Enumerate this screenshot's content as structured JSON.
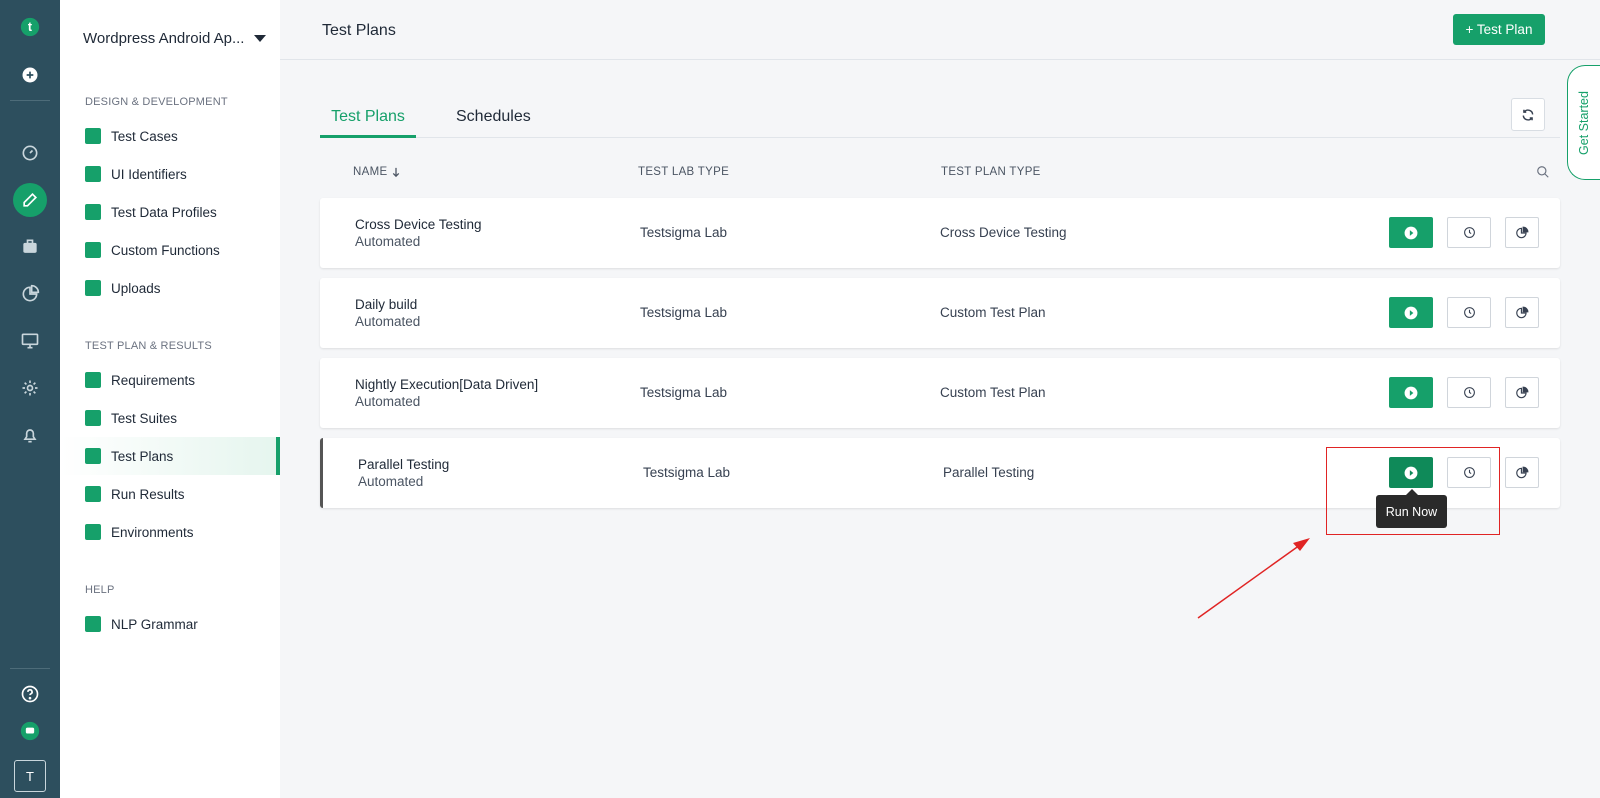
{
  "rail": {
    "logo_letter": "t",
    "user_initial": "T"
  },
  "sidenav": {
    "project_name": "Wordpress Android Ap...",
    "sections": [
      {
        "title": "DESIGN & DEVELOPMENT",
        "items": [
          "Test Cases",
          "UI Identifiers",
          "Test Data Profiles",
          "Custom Functions",
          "Uploads"
        ]
      },
      {
        "title": "TEST PLAN & RESULTS",
        "items": [
          "Requirements",
          "Test Suites",
          "Test Plans",
          "Run Results",
          "Environments"
        ]
      },
      {
        "title": "HELP",
        "items": [
          "NLP Grammar"
        ]
      }
    ],
    "active_item": "Test Plans"
  },
  "header": {
    "title": "Test Plans",
    "new_button": "+ Test Plan"
  },
  "get_started": "Get Started",
  "tabs": [
    "Test Plans",
    "Schedules"
  ],
  "table": {
    "columns": [
      "NAME",
      "TEST LAB TYPE",
      "TEST PLAN TYPE"
    ],
    "rows": [
      {
        "name": "Cross Device Testing",
        "sub": "Automated",
        "lab": "Testsigma Lab",
        "type": "Cross Device Testing"
      },
      {
        "name": "Daily build",
        "sub": "Automated",
        "lab": "Testsigma Lab",
        "type": "Custom Test Plan"
      },
      {
        "name": "Nightly Execution[Data Driven]",
        "sub": "Automated",
        "lab": "Testsigma Lab",
        "type": "Custom Test Plan"
      },
      {
        "name": "Parallel Testing",
        "sub": "Automated",
        "lab": "Testsigma Lab",
        "type": "Parallel Testing"
      }
    ]
  },
  "tooltip": "Run Now",
  "colors": {
    "accent": "#16a06a",
    "rail": "#2d4f5e",
    "annotation": "#e02424"
  }
}
